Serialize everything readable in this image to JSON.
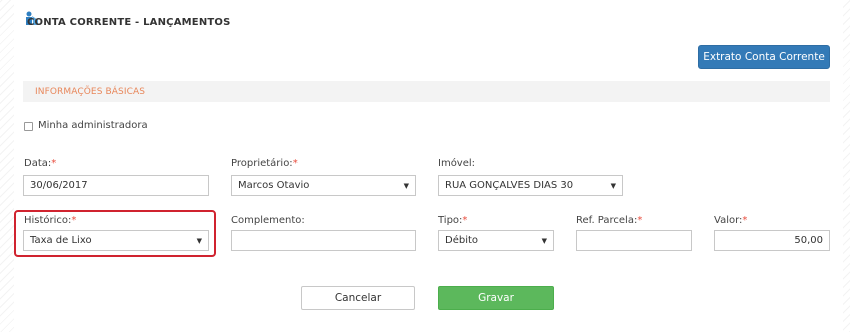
{
  "header": {
    "title": "CONTA CORRENTE - LANÇAMENTOS",
    "logo_icon": "home-logo-icon"
  },
  "actions": {
    "extrato_label": "Extrato Conta Corrente"
  },
  "section": {
    "title": "INFORMAÇÕES BÁSICAS"
  },
  "checkbox": {
    "label": "Minha administradora",
    "checked": false
  },
  "fields": {
    "data": {
      "label": "Data:",
      "value": "30/06/2017",
      "required": "*"
    },
    "proprietario": {
      "label": "Proprietário:",
      "value": "Marcos Otavio",
      "required": "*"
    },
    "imovel": {
      "label": "Imóvel:",
      "value": "RUA GONÇALVES DIAS 30"
    },
    "historico": {
      "label": "Histórico:",
      "value": "Taxa de Lixo",
      "required": "*"
    },
    "complemento": {
      "label": "Complemento:",
      "value": ""
    },
    "tipo": {
      "label": "Tipo:",
      "value": "Débito",
      "required": "*"
    },
    "ref_parcela": {
      "label": "Ref. Parcela:",
      "value": "",
      "required": "*"
    },
    "valor": {
      "label": "Valor:",
      "value": "50,00",
      "required": "*"
    }
  },
  "buttons": {
    "cancel_label": "Cancelar",
    "save_label": "Gravar"
  },
  "colors": {
    "primary": "#337ab7",
    "success": "#5cb85c",
    "section_title": "#e8875b",
    "required": "#e84c3d",
    "highlight": "#d0232f"
  }
}
